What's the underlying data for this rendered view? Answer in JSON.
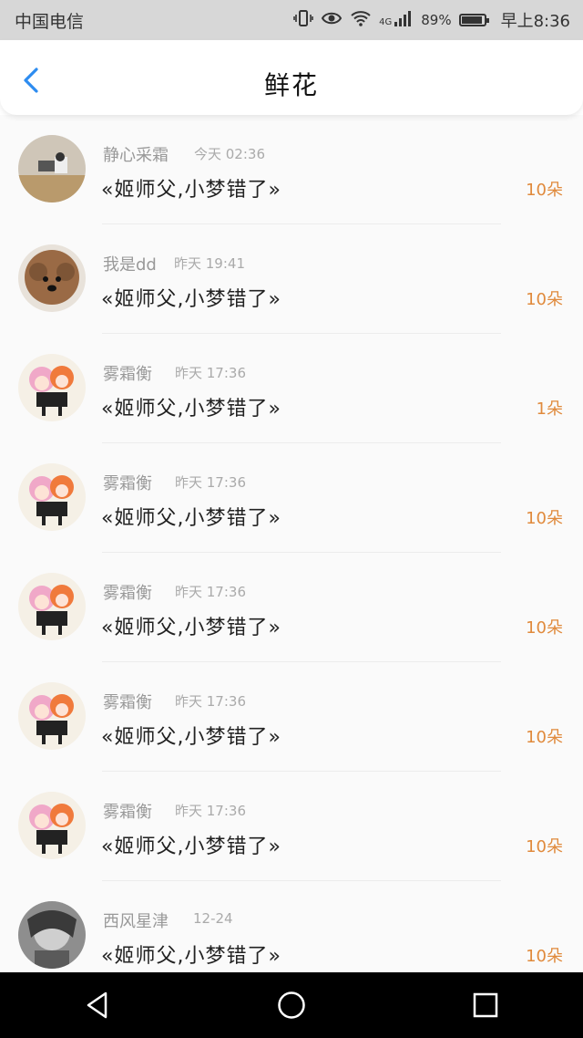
{
  "status_bar": {
    "carrier": "中国电信",
    "network": "4G",
    "battery": "89%",
    "time": "早上8:36"
  },
  "header": {
    "title": "鲜花"
  },
  "colors": {
    "back_arrow": "#2d8cf0",
    "count": "#e08a3c",
    "nav_background": "#000000"
  },
  "list": {
    "items": [
      {
        "name": "静心采霜",
        "time": "今天 02:36",
        "message": "«姬师父,小梦错了»",
        "count": "10朵",
        "avatar": "photo-cat"
      },
      {
        "name": "我是dd",
        "time": "昨天 19:41",
        "message": "«姬师父,小梦错了»",
        "count": "10朵",
        "avatar": "photo-dog"
      },
      {
        "name": "雾霜衡",
        "time": "昨天 17:36",
        "message": "«姬师父,小梦错了»",
        "count": "1朵",
        "avatar": "anime-girls"
      },
      {
        "name": "雾霜衡",
        "time": "昨天 17:36",
        "message": "«姬师父,小梦错了»",
        "count": "10朵",
        "avatar": "anime-girls"
      },
      {
        "name": "雾霜衡",
        "time": "昨天 17:36",
        "message": "«姬师父,小梦错了»",
        "count": "10朵",
        "avatar": "anime-girls"
      },
      {
        "name": "雾霜衡",
        "time": "昨天 17:36",
        "message": "«姬师父,小梦错了»",
        "count": "10朵",
        "avatar": "anime-girls"
      },
      {
        "name": "雾霜衡",
        "time": "昨天 17:36",
        "message": "«姬师父,小梦错了»",
        "count": "10朵",
        "avatar": "anime-girls"
      },
      {
        "name": "西风星津",
        "time": "12-24",
        "message": "«姬师父,小梦错了»",
        "count": "10朵",
        "avatar": "sketch-portrait"
      }
    ]
  }
}
